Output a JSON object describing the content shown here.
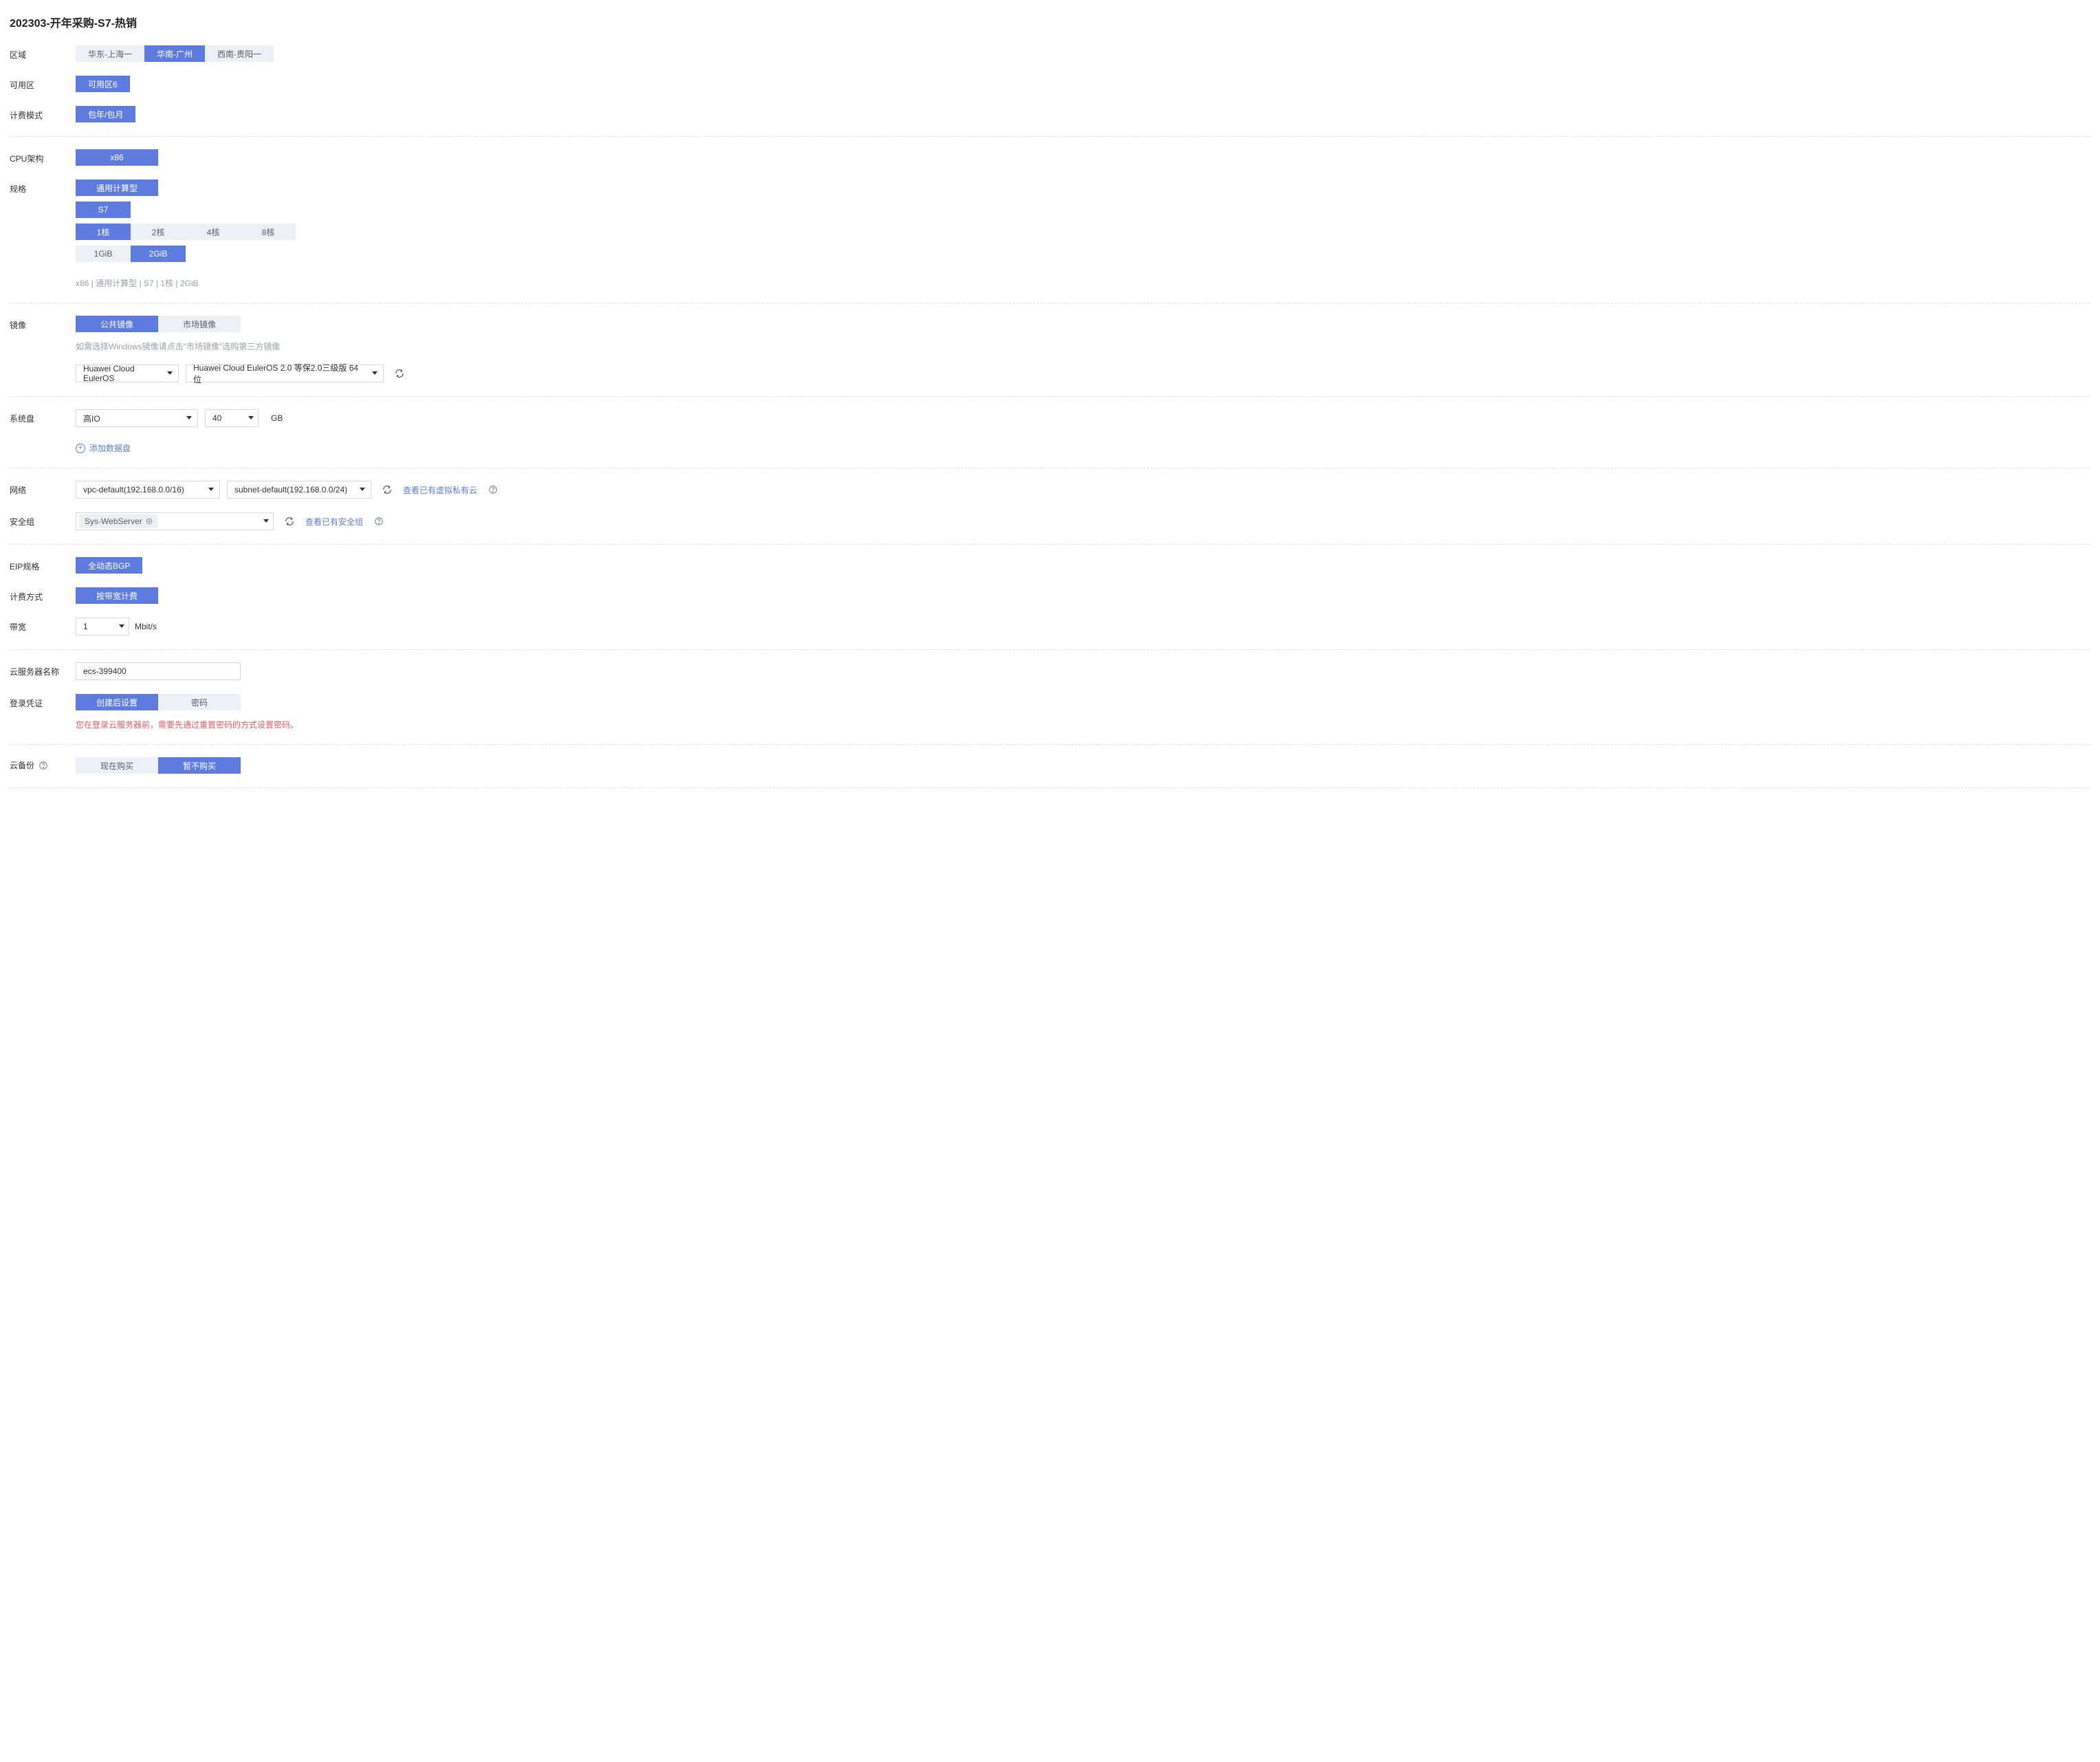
{
  "title": "202303-开年采购-S7-热销",
  "region": {
    "label": "区域",
    "options": [
      "华东-上海一",
      "华南-广州",
      "西南-贵阳一"
    ],
    "active": "华南-广州"
  },
  "az": {
    "label": "可用区",
    "options": [
      "可用区6"
    ],
    "active": "可用区6"
  },
  "billing": {
    "label": "计费模式",
    "options": [
      "包年/包月"
    ],
    "active": "包年/包月"
  },
  "cpu_arch": {
    "label": "CPU架构",
    "options": [
      "x86"
    ],
    "active": "x86"
  },
  "spec": {
    "label": "规格",
    "type_options": [
      "通用计算型"
    ],
    "type_active": "通用计算型",
    "series_options": [
      "S7"
    ],
    "series_active": "S7",
    "core_options": [
      "1核",
      "2核",
      "4核",
      "8核"
    ],
    "core_active": "1核",
    "mem_options": [
      "1GiB",
      "2GiB"
    ],
    "mem_active": "2GiB",
    "summary": "x86 | 通用计算型 | S7 | 1核 | 2GiB"
  },
  "image": {
    "label": "镜像",
    "tab_options": [
      "公共镜像",
      "市场镜像"
    ],
    "tab_active": "公共镜像",
    "hint": "如需选择Windows镜像请点击\"市场镜像\"选购第三方镜像",
    "os_select": "Huawei Cloud EulerOS",
    "version_select": "Huawei Cloud EulerOS 2.0 等保2.0三级版 64位"
  },
  "system_disk": {
    "label": "系统盘",
    "type_select": "高IO",
    "size": "40",
    "unit": "GB",
    "add_link": "添加数据盘"
  },
  "network": {
    "label": "网络",
    "vpc_select": "vpc-default(192.168.0.0/16)",
    "subnet_select": "subnet-default(192.168.0.0/24)",
    "vpc_link": "查看已有虚拟私有云"
  },
  "security_group": {
    "label": "安全组",
    "chip": "Sys-WebServer",
    "link": "查看已有安全组"
  },
  "eip_spec": {
    "label": "EIP规格",
    "options": [
      "全动态BGP"
    ],
    "active": "全动态BGP"
  },
  "charge_mode": {
    "label": "计费方式",
    "options": [
      "按带宽计费"
    ],
    "active": "按带宽计费"
  },
  "bandwidth": {
    "label": "带宽",
    "value": "1",
    "unit": "Mbit/s"
  },
  "server_name": {
    "label": "云服务器名称",
    "value": "ecs-399400"
  },
  "login": {
    "label": "登录凭证",
    "options": [
      "创建后设置",
      "密码"
    ],
    "active": "创建后设置",
    "hint": "您在登录云服务器前，需要先通过重置密码的方式设置密码。"
  },
  "backup": {
    "label": "云备份",
    "options": [
      "现在购买",
      "暂不购买"
    ],
    "active": "暂不购买"
  }
}
